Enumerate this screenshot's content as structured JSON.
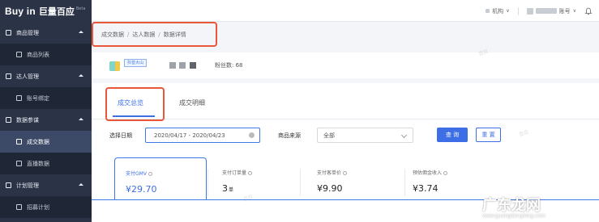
{
  "header": {
    "brand": "Buy in",
    "brand_cn": "巨量百应",
    "beta": "Beta",
    "org_label": "机构",
    "account_label": "账号",
    "colors": {
      "sidebar_bg": "#2b3347",
      "primary": "#3d6ee6",
      "highlight": "#e8573a"
    }
  },
  "sidebar": {
    "groups": [
      {
        "label": "商品管理",
        "items": [
          {
            "label": "商品列表",
            "active": false
          }
        ]
      },
      {
        "label": "达人管理",
        "items": [
          {
            "label": "账号绑定",
            "active": false
          }
        ]
      },
      {
        "label": "数据参谋",
        "items": [
          {
            "label": "成交数据",
            "active": true
          },
          {
            "label": "直播数据",
            "active": false
          }
        ]
      },
      {
        "label": "计划管理",
        "items": [
          {
            "label": "招募计划",
            "active": false
          }
        ]
      }
    ]
  },
  "breadcrumb": [
    "成交数据",
    "达人数据",
    "数据详情"
  ],
  "profile": {
    "tag": "抖音大山",
    "fans_label": "粉丝数: 68"
  },
  "tabs": [
    {
      "label": "成交总览",
      "active": true
    },
    {
      "label": "成交明细",
      "active": false
    }
  ],
  "filters": {
    "date_label": "选择日期",
    "date_range": "2020/04/17  -  2020/04/23",
    "source_label": "商品来源",
    "source_value": "全部",
    "query_button": "查 询",
    "reset_button": "重 置"
  },
  "metrics": [
    {
      "label": "支付GMV",
      "value": "¥29.70",
      "unit": "",
      "active": true
    },
    {
      "label": "支付订单量",
      "value": "3",
      "unit": "单",
      "active": false
    },
    {
      "label": "支付客单价",
      "value": "¥9.90",
      "unit": "",
      "active": false
    },
    {
      "label": "预估佣金收入",
      "value": "¥3.74",
      "unit": "",
      "active": false
    }
  ],
  "watermark_text": "百应",
  "site_watermark": {
    "text": "广东龙网",
    "sub": "www.guangdonglong.com"
  }
}
